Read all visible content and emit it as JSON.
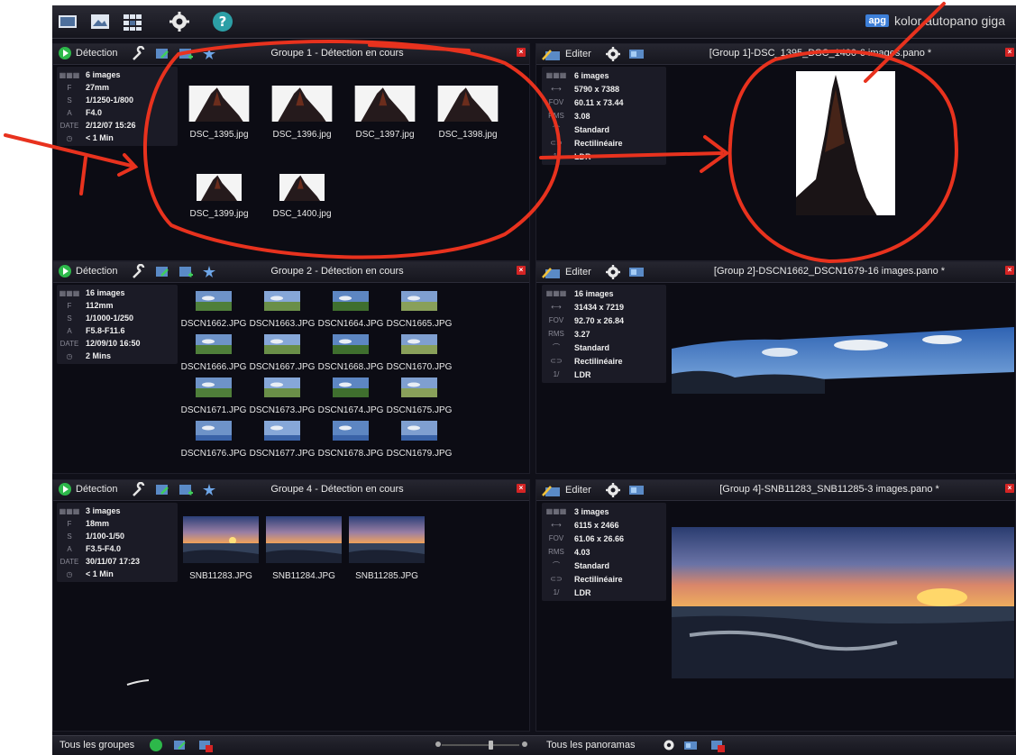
{
  "brand": {
    "logo": "apg",
    "name": "kolor autopano giga"
  },
  "toolbar_icons": [
    "open-images-icon",
    "open-folder-icon",
    "grid-icon",
    "settings-icon",
    "help-icon"
  ],
  "groups": [
    {
      "detect_label": "Détection",
      "title": "Groupe 1 - Détection en cours",
      "info": [
        {
          "key": "▦▦▦",
          "value": "6 images"
        },
        {
          "key": "F",
          "value": "27mm"
        },
        {
          "key": "S",
          "value": "1/1250-1/800"
        },
        {
          "key": "A",
          "value": "F4.0"
        },
        {
          "key": "DATE",
          "value": "2/12/07 15:26"
        },
        {
          "key": "◷",
          "value": "< 1 Min"
        }
      ],
      "thumbs": [
        "DSC_1395.jpg",
        "DSC_1396.jpg",
        "DSC_1397.jpg",
        "DSC_1398.jpg",
        "DSC_1399.jpg",
        "DSC_1400.jpg"
      ]
    },
    {
      "detect_label": "Détection",
      "title": "Groupe 2 - Détection en cours",
      "info": [
        {
          "key": "▦▦▦",
          "value": "16 images"
        },
        {
          "key": "F",
          "value": "112mm"
        },
        {
          "key": "S",
          "value": "1/1000-1/250"
        },
        {
          "key": "A",
          "value": "F5.8-F11.6"
        },
        {
          "key": "DATE",
          "value": "12/09/10 16:50"
        },
        {
          "key": "◷",
          "value": "2 Mins"
        }
      ],
      "thumbs": [
        "DSCN1662.JPG",
        "DSCN1663.JPG",
        "DSCN1664.JPG",
        "DSCN1665.JPG",
        "DSCN1666.JPG",
        "DSCN1667.JPG",
        "DSCN1668.JPG",
        "DSCN1670.JPG",
        "DSCN1671.JPG",
        "DSCN1673.JPG",
        "DSCN1674.JPG",
        "DSCN1675.JPG",
        "DSCN1676.JPG",
        "DSCN1677.JPG",
        "DSCN1678.JPG",
        "DSCN1679.JPG"
      ]
    },
    {
      "detect_label": "Détection",
      "title": "Groupe 4 - Détection en cours",
      "info": [
        {
          "key": "▦▦▦",
          "value": "3 images"
        },
        {
          "key": "F",
          "value": "18mm"
        },
        {
          "key": "S",
          "value": "1/100-1/50"
        },
        {
          "key": "A",
          "value": "F3.5-F4.0"
        },
        {
          "key": "DATE",
          "value": "30/11/07 17:23"
        },
        {
          "key": "◷",
          "value": "< 1 Min"
        }
      ],
      "thumbs": [
        "SNB11283.JPG",
        "SNB11284.JPG",
        "SNB11285.JPG"
      ]
    }
  ],
  "panoramas": [
    {
      "edit_label": "Editer",
      "title": "[Group 1]-DSC_1395_DSC_1400-6 images.pano *",
      "info": [
        {
          "key": "▦▦▦",
          "value": "6 images"
        },
        {
          "key": "⟷",
          "value": "5790 x 7388"
        },
        {
          "key": "FOV",
          "value": "60.11 x 73.44"
        },
        {
          "key": "RMS",
          "value": "3.08"
        },
        {
          "key": "⌒",
          "value": "Standard"
        },
        {
          "key": "⊂⊃",
          "value": "Rectilinéaire"
        },
        {
          "key": "1/",
          "value": "LDR"
        }
      ]
    },
    {
      "edit_label": "Editer",
      "title": "[Group 2]-DSCN1662_DSCN1679-16 images.pano *",
      "info": [
        {
          "key": "▦▦▦",
          "value": "16 images"
        },
        {
          "key": "⟷",
          "value": "31434 x 7219"
        },
        {
          "key": "FOV",
          "value": "92.70 x 26.84"
        },
        {
          "key": "RMS",
          "value": "3.27"
        },
        {
          "key": "⌒",
          "value": "Standard"
        },
        {
          "key": "⊂⊃",
          "value": "Rectilinéaire"
        },
        {
          "key": "1/",
          "value": "LDR"
        }
      ]
    },
    {
      "edit_label": "Editer",
      "title": "[Group 4]-SNB11283_SNB11285-3 images.pano *",
      "info": [
        {
          "key": "▦▦▦",
          "value": "3 images"
        },
        {
          "key": "⟷",
          "value": "6115 x 2466"
        },
        {
          "key": "FOV",
          "value": "61.06 x 26.66"
        },
        {
          "key": "RMS",
          "value": "4.03"
        },
        {
          "key": "⌒",
          "value": "Standard"
        },
        {
          "key": "⊂⊃",
          "value": "Rectilinéaire"
        },
        {
          "key": "1/",
          "value": "LDR"
        }
      ]
    }
  ],
  "bottom": {
    "all_groups": "Tous les groupes",
    "all_panoramas": "Tous les panoramas"
  },
  "close_glyph": "×",
  "colors": {
    "accent_green": "#2db84a",
    "close_red": "#d42424",
    "annotation_red": "#e8321e"
  }
}
